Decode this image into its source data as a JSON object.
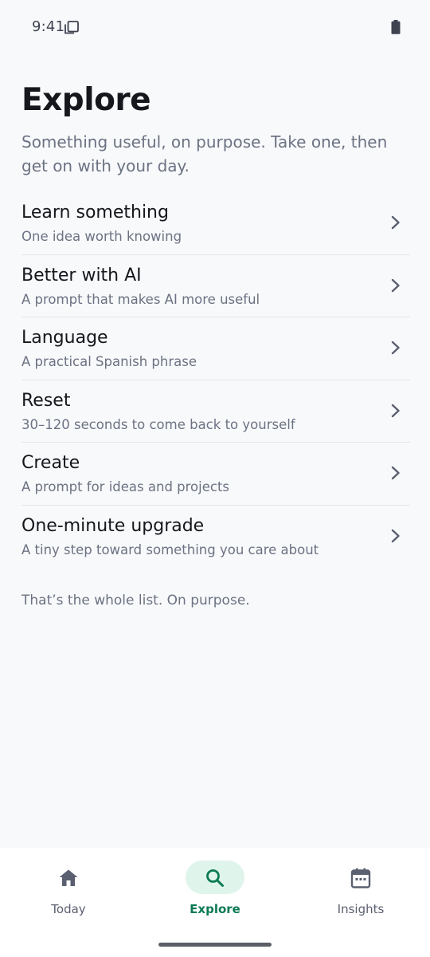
{
  "status_bar": {
    "time": "9:41",
    "icons": [
      "notification-copy-icon",
      "battery-icon"
    ]
  },
  "header": {
    "title": "Explore",
    "subtitle": "Something useful, on purpose. Take one, then get on with your day."
  },
  "list": {
    "items": [
      {
        "title": "Learn something",
        "description": "One idea worth knowing"
      },
      {
        "title": "Better with AI",
        "description": "A prompt that makes AI more useful"
      },
      {
        "title": "Language",
        "description": "A practical Spanish phrase"
      },
      {
        "title": "Reset",
        "description": "30–120 seconds to come back to yourself"
      },
      {
        "title": "Create",
        "description": "A prompt for ideas and projects"
      },
      {
        "title": "One-minute upgrade",
        "description": "A tiny step toward something you care about"
      }
    ],
    "footer": "That’s the whole list. On purpose."
  },
  "bottom_nav": {
    "items": [
      {
        "label": "Today",
        "icon": "home-icon",
        "active": false
      },
      {
        "label": "Explore",
        "icon": "search-icon",
        "active": true
      },
      {
        "label": "Insights",
        "icon": "calendar-icon",
        "active": false
      }
    ]
  },
  "colors": {
    "background": "#f8f9fb",
    "text_primary": "#15171c",
    "text_secondary": "#6b7282",
    "accent": "#0c7a55",
    "accent_pill": "#dff5ec",
    "divider": "#e2e5ea"
  }
}
